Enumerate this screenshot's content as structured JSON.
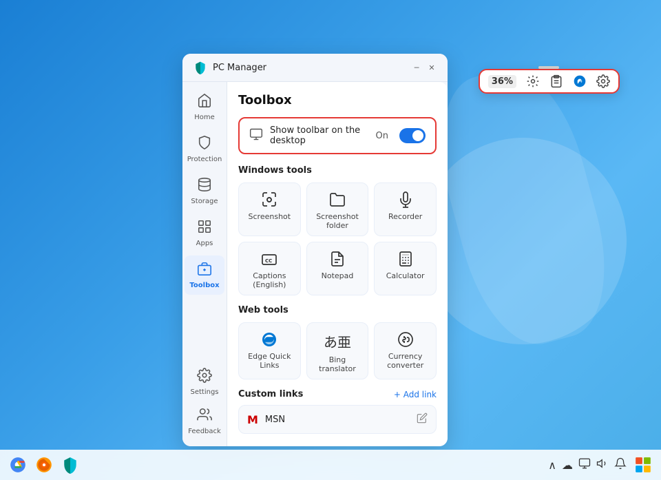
{
  "desktop": {
    "background": "blue gradient"
  },
  "floating_toolbar": {
    "battery_label": "36%",
    "items": [
      {
        "name": "battery",
        "symbol": "36%"
      },
      {
        "name": "settings-gear",
        "symbol": "⚙"
      },
      {
        "name": "clipboard",
        "symbol": "📋"
      },
      {
        "name": "edge-browser",
        "symbol": "🌐"
      },
      {
        "name": "gear-settings",
        "symbol": "⚙"
      }
    ]
  },
  "window": {
    "title": "PC Manager",
    "minimize_label": "─",
    "close_label": "✕"
  },
  "sidebar": {
    "items": [
      {
        "id": "home",
        "label": "Home",
        "icon": "⌂"
      },
      {
        "id": "protection",
        "label": "Protection",
        "icon": "🛡"
      },
      {
        "id": "storage",
        "label": "Storage",
        "icon": "📦"
      },
      {
        "id": "apps",
        "label": "Apps",
        "icon": "⊞"
      },
      {
        "id": "toolbox",
        "label": "Toolbox",
        "icon": "🧰"
      }
    ],
    "bottom_items": [
      {
        "id": "settings",
        "label": "Settings",
        "icon": "⚙"
      },
      {
        "id": "feedback",
        "label": "Feedback",
        "icon": "👤"
      }
    ]
  },
  "content": {
    "title": "Toolbox",
    "toolbar_toggle": {
      "icon": "🖥",
      "label": "Show toolbar on the desktop",
      "status": "On"
    },
    "windows_tools_section": "Windows tools",
    "windows_tools": [
      {
        "id": "screenshot",
        "label": "Screenshot",
        "icon": "⚙"
      },
      {
        "id": "screenshot-folder",
        "label": "Screenshot folder",
        "icon": "📁"
      },
      {
        "id": "recorder",
        "label": "Recorder",
        "icon": "🎙"
      },
      {
        "id": "captions",
        "label": "Captions (English)",
        "icon": "CC"
      },
      {
        "id": "notepad",
        "label": "Notepad",
        "icon": "📝"
      },
      {
        "id": "calculator",
        "label": "Calculator",
        "icon": "🖩"
      }
    ],
    "web_tools_section": "Web tools",
    "web_tools": [
      {
        "id": "edge-quick-links",
        "label": "Edge Quick Links",
        "icon": "🔵"
      },
      {
        "id": "bing-translator",
        "label": "Bing translator",
        "icon": "あ"
      },
      {
        "id": "currency-converter",
        "label": "Currency converter",
        "icon": "💱"
      }
    ],
    "custom_links_section": "Custom links",
    "add_link_label": "+ Add link",
    "custom_links": [
      {
        "id": "msn",
        "label": "MSN",
        "icon": "🟥"
      }
    ]
  },
  "taskbar": {
    "left_apps": [
      {
        "id": "chrome",
        "icon": "🌐",
        "color": "#4285f4"
      },
      {
        "id": "firefox",
        "icon": "🦊"
      },
      {
        "id": "pcmanager",
        "icon": "🟦"
      }
    ],
    "right_icons": [
      "∧",
      "☁",
      "🖥",
      "🔊",
      "🔔"
    ],
    "colorful_icon": "🎨"
  }
}
